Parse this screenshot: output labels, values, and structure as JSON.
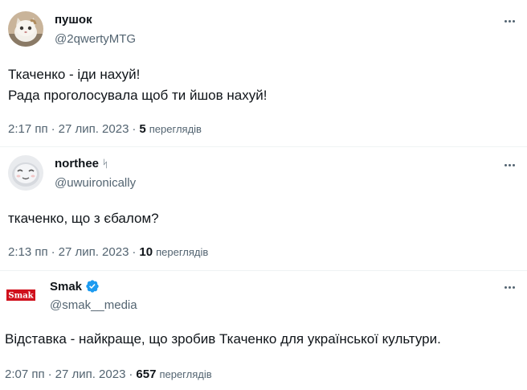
{
  "tweets": [
    {
      "display_name": "пушок",
      "handle": "@2qwertyMTG",
      "text_lines": [
        "Ткаченко - іди нахуй!",
        "Рада проголосувала щоб ти йшов нахуй!"
      ],
      "time": "2:17 пп",
      "date": "27 лип. 2023",
      "views_count": "5",
      "views_label": "переглядів",
      "avatar": "cat-avatar",
      "badge": ""
    },
    {
      "display_name": "northee",
      "handle": "@uwuironically",
      "text_lines": [
        "ткаченко, що з єбалом?"
      ],
      "time": "2:13 пп",
      "date": "27 лип. 2023",
      "views_count": "10",
      "views_label": "переглядів",
      "avatar": "cartoon-face-avatar",
      "badge": "ᛋ"
    },
    {
      "display_name": "Smak",
      "handle": "@smak__media",
      "text_lines": [
        "Відставка - найкраще, що зробив Ткаченко для української культури."
      ],
      "time": "2:07 пп",
      "date": "27 лип. 2023",
      "views_count": "657",
      "views_label": "переглядів",
      "avatar": "smak-logo",
      "logo_text": "Smak",
      "verified": true,
      "verified_color": "#1d9bf0"
    }
  ],
  "separator": "·",
  "colors": {
    "text_primary": "#0f1419",
    "text_secondary": "#536471",
    "smak_red": "#d0101c"
  }
}
